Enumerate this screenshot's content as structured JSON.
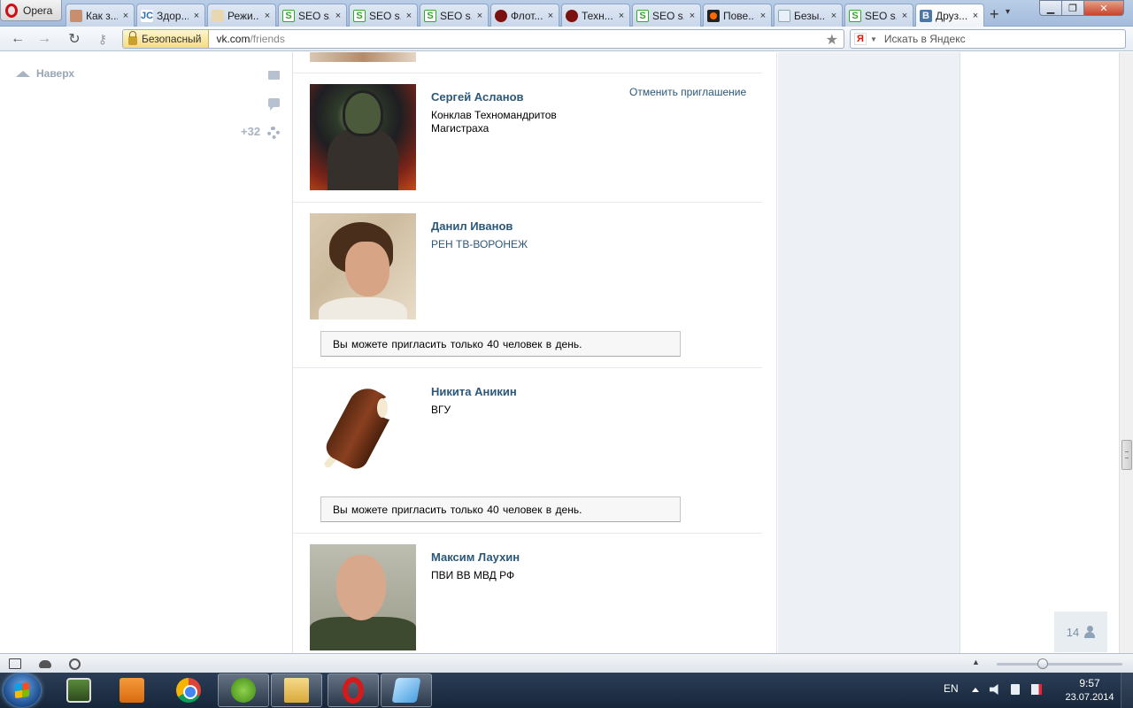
{
  "browser": {
    "menu_label": "Opera",
    "tabs": [
      {
        "title": "Как з...",
        "icon": "face-favicon"
      },
      {
        "title": "Здор...",
        "icon": "jc-favicon",
        "badge": "JC"
      },
      {
        "title": "Режи...",
        "icon": "mode-favicon"
      },
      {
        "title": "SEO s...",
        "icon": "seo-favicon",
        "badge": "S"
      },
      {
        "title": "SEO s...",
        "icon": "seo-favicon",
        "badge": "S"
      },
      {
        "title": "SEO s...",
        "icon": "seo-favicon",
        "badge": "S"
      },
      {
        "title": "Флот...",
        "icon": "red-circle-favicon"
      },
      {
        "title": "Техн...",
        "icon": "red-circle-favicon"
      },
      {
        "title": "SEO s...",
        "icon": "seo-favicon",
        "badge": "S"
      },
      {
        "title": "Пове...",
        "icon": "orange-dot-favicon"
      },
      {
        "title": "Безы...",
        "icon": "doc-favicon"
      },
      {
        "title": "SEO s...",
        "icon": "seo-favicon",
        "badge": "S"
      },
      {
        "title": "Друз...",
        "icon": "vk-favicon",
        "badge": "B",
        "active": true
      }
    ],
    "new_tab": "+",
    "close_glyph": "×",
    "security_label": "Безопасный",
    "url_host": "vk.com",
    "url_path": "/friends",
    "search_badge": "Я",
    "search_placeholder": "Искать в Яндекс"
  },
  "left_menu": {
    "up_link": "Наверх",
    "notification_count": "+32"
  },
  "friends": [
    {
      "name": "Сергей Асланов",
      "info": "Конклав Техномандритов Магистраха",
      "action": "Отменить приглашение"
    },
    {
      "name": "Данил Иванов",
      "info": "РЕН ТВ-ВОРОНЕЖ",
      "note": "Вы можете пригласить только 40 человек в день."
    },
    {
      "name": "Никита Аникин",
      "info": "ВГУ",
      "note": "Вы можете пригласить только 40 человек в день."
    },
    {
      "name": "Максим Лаухин",
      "info": "ПВИ ВВ МВД РФ"
    }
  ],
  "chat": {
    "online_count": "14"
  },
  "taskbar": {
    "language": "EN",
    "time": "9:57",
    "date": "23.07.2014"
  },
  "colors": {
    "link": "#2b587a",
    "sidebar_bg": "#edf0f4",
    "taskbar_bg": "#1f3048"
  }
}
